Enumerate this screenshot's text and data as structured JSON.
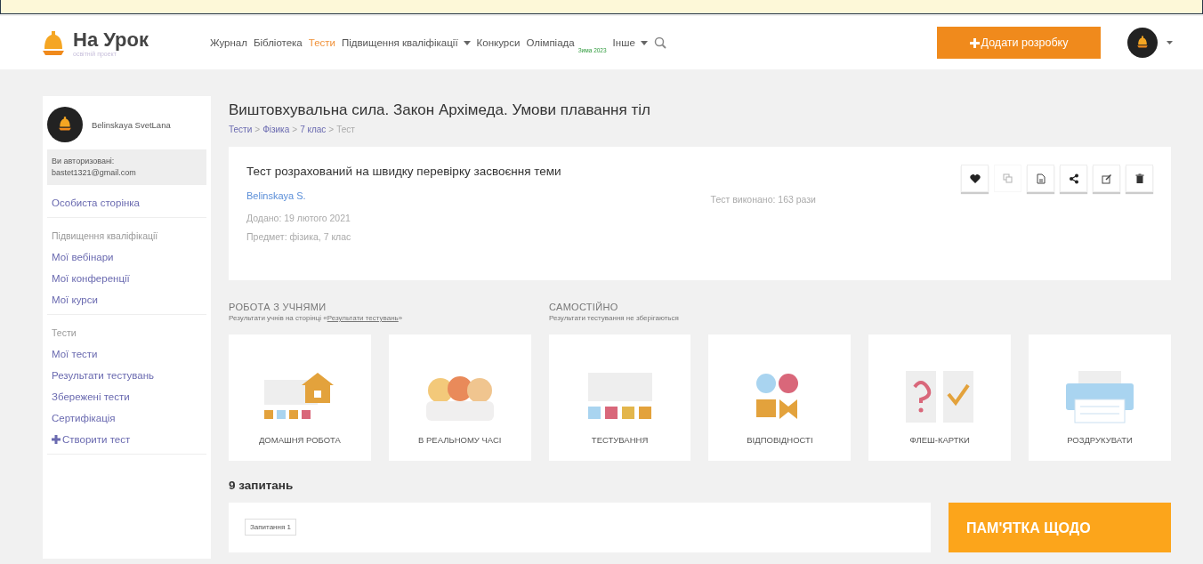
{
  "logo": {
    "title": "На Урок",
    "subtitle": "освітній проект"
  },
  "nav": [
    {
      "label": "Журнал",
      "selected": false,
      "dropdown": false
    },
    {
      "label": "Бібліотека",
      "selected": false,
      "dropdown": false
    },
    {
      "label": "Тести",
      "selected": true,
      "dropdown": false
    },
    {
      "label": "Підвищення кваліфікації",
      "selected": false,
      "dropdown": true
    },
    {
      "label": "Конкурси",
      "selected": false,
      "dropdown": false
    },
    {
      "label": "Олімпіада",
      "selected": false,
      "dropdown": false,
      "badge": "Зима 2023"
    },
    {
      "label": "Інше",
      "selected": false,
      "dropdown": true
    }
  ],
  "add_button": "Додати розробку",
  "sidebar": {
    "user": "Belinskaya SvetLana",
    "auth_label": "Ви авторизовані:",
    "email": "bastet1321@gmail.com",
    "groups": [
      [
        {
          "label": "Особиста сторінка",
          "kind": "link"
        }
      ],
      [
        {
          "label": "Підвищення кваліфікації",
          "kind": "heading"
        },
        {
          "label": "Мої вебінари",
          "kind": "link"
        },
        {
          "label": "Мої конференції",
          "kind": "link"
        },
        {
          "label": "Мої курси",
          "kind": "link"
        }
      ],
      [
        {
          "label": "Тести",
          "kind": "heading"
        },
        {
          "label": "Мої тести",
          "kind": "link"
        },
        {
          "label": "Результати тестувань",
          "kind": "link"
        },
        {
          "label": "Збережені тести",
          "kind": "link"
        },
        {
          "label": "Сертифікація",
          "kind": "link"
        },
        {
          "label": "Створити тест",
          "kind": "create"
        }
      ]
    ]
  },
  "title": "Виштовхувальна сила. Закон Архімеда. Умови плавання тіл",
  "breadcrumb_separator": ">",
  "breadcrumbs": [
    {
      "label": "Тести",
      "link": true
    },
    {
      "label": "Фізика",
      "link": true
    },
    {
      "label": "7 клас",
      "link": true
    },
    {
      "label": "Тест",
      "link": false
    }
  ],
  "info": {
    "description": "Тест розрахований на швидку перевірку засвоєння теми",
    "author": "Belinskaya S.",
    "added": "Додано: 19 лютого 2021",
    "subject": "Предмет: фізика, 7 клас",
    "runs": "Тест виконано: 163 рази",
    "actions": [
      {
        "kind": "heart",
        "disabled": false
      },
      {
        "kind": "copy",
        "disabled": true
      },
      {
        "kind": "file",
        "disabled": false
      },
      {
        "kind": "share",
        "disabled": false
      },
      {
        "kind": "edit",
        "disabled": false
      },
      {
        "kind": "trash",
        "disabled": false
      }
    ]
  },
  "modes": [
    {
      "heading": "РОБОТА З УЧНЯМИ",
      "desc_before": "Результати учнів на сторінці «",
      "link": "Результати тестувань",
      "desc_after": "»"
    },
    {
      "heading": "САМОСТІЙНО",
      "desc_before": "Результати тестування не зберігаються"
    }
  ],
  "tiles": [
    {
      "kind": "homework",
      "label": "ДОМАШНЯ РОБОТА"
    },
    {
      "kind": "live",
      "label": "В РЕАЛЬНОМУ ЧАСІ"
    },
    {
      "kind": "test",
      "label": "ТЕСТУВАННЯ"
    },
    {
      "kind": "match",
      "label": "ВІДПОВІДНОСТІ"
    },
    {
      "kind": "cards",
      "label": "ФЛЕШ-КАРТКИ"
    },
    {
      "kind": "print",
      "label": "РОЗДРУКУВАТИ"
    }
  ],
  "questions_count": "9 запитань",
  "question_label": "Запитання 1",
  "memo": "ПАМ'ЯТКА ЩОДО"
}
